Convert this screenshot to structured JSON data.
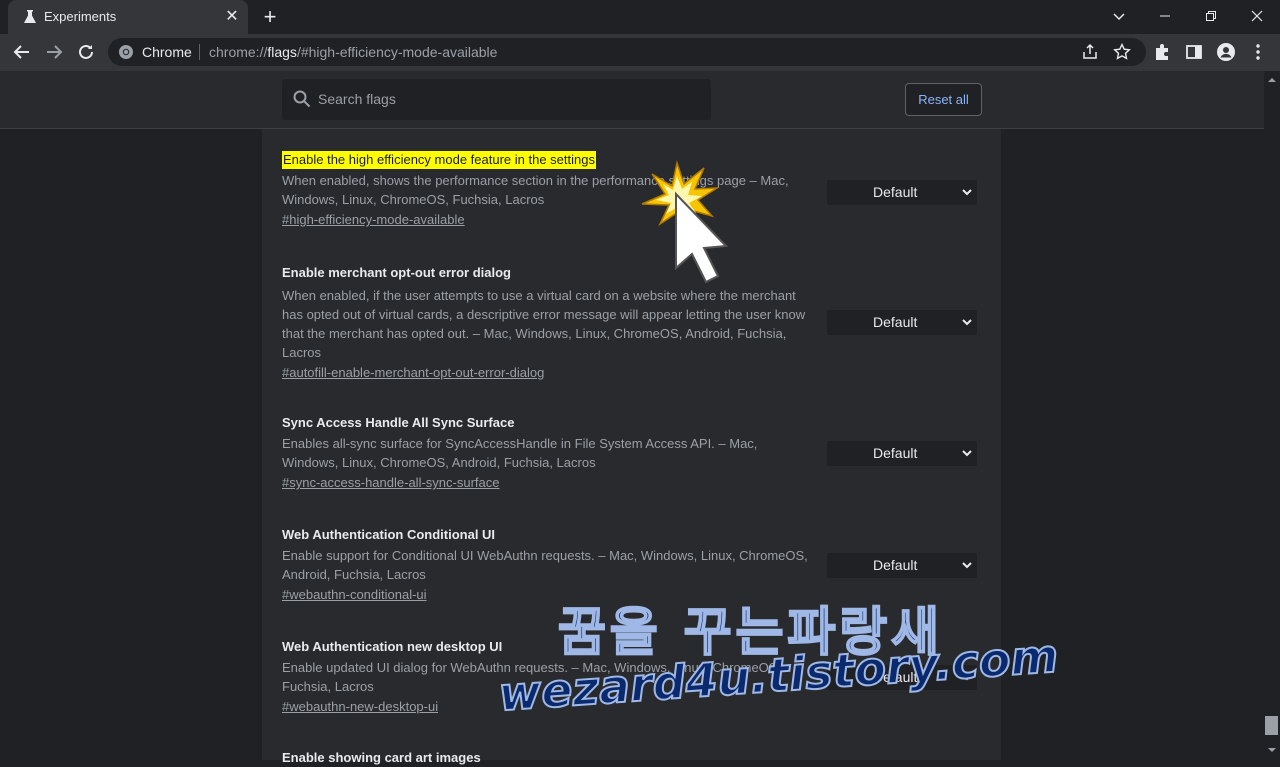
{
  "browser": {
    "tab_title": "Experiments",
    "omnibox_label": "Chrome",
    "url_scheme": "chrome://",
    "url_host": "flags",
    "url_path": "/#high-efficiency-mode-available"
  },
  "header": {
    "search_placeholder": "Search flags",
    "reset_label": "Reset all"
  },
  "flags": [
    {
      "name": "Enable the high efficiency mode feature in the settings",
      "description": "When enabled, shows the performance section in the performance settings page – Mac, Windows, Linux, ChromeOS, Fuchsia, Lacros",
      "link": "#high-efficiency-mode-available",
      "value": "Default",
      "highlighted": true
    },
    {
      "name": "Enable merchant opt-out error dialog",
      "description": "When enabled, if the user attempts to use a virtual card on a website where the merchant has opted out of virtual cards, a descriptive error message will appear letting the user know that the merchant has opted out. – Mac, Windows, Linux, ChromeOS, Android, Fuchsia, Lacros",
      "link": "#autofill-enable-merchant-opt-out-error-dialog",
      "value": "Default"
    },
    {
      "name": "Sync Access Handle All Sync Surface",
      "description": "Enables all-sync surface for SyncAccessHandle in File System Access API. – Mac, Windows, Linux, ChromeOS, Android, Fuchsia, Lacros",
      "link": "#sync-access-handle-all-sync-surface",
      "value": "Default"
    },
    {
      "name": "Web Authentication Conditional UI",
      "description": "Enable support for Conditional UI WebAuthn requests. – Mac, Windows, Linux, ChromeOS, Android, Fuchsia, Lacros",
      "link": "#webauthn-conditional-ui",
      "value": "Default"
    },
    {
      "name": "Web Authentication new desktop UI",
      "description": "Enable updated UI dialog for WebAuthn requests. – Mac, Windows, Linux, ChromeOS, Fuchsia, Lacros",
      "link": "#webauthn-new-desktop-ui",
      "value": "Default"
    },
    {
      "name": "Enable showing card art images",
      "description": "",
      "link": "",
      "value": ""
    }
  ],
  "watermark": {
    "korean": "꿈을 꾸는파랑새",
    "site": "wezard4u.tistory.com"
  }
}
